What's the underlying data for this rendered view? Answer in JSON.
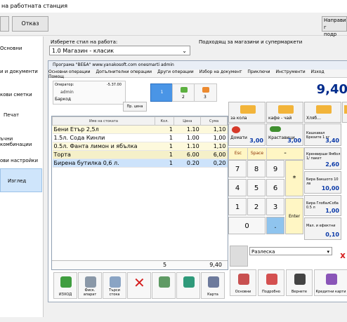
{
  "window": {
    "title": "на работната станция"
  },
  "toolbar": {
    "ok_label": "",
    "cancel_label": "Отказ",
    "right_label_1": "Направи г",
    "right_label_2": "подр"
  },
  "sidebar": {
    "items": [
      {
        "label": "Основни"
      },
      {
        "label": "и и документи"
      },
      {
        "label": "кови сметки"
      },
      {
        "label": "Печат"
      },
      {
        "label": "ъчни комбинации"
      },
      {
        "label": "ови настройки"
      },
      {
        "label": "Изглед"
      }
    ]
  },
  "main": {
    "style_label": "Изберете стил на работа:",
    "style_value": "1.0 Магазин - класик",
    "style_hint": "Подходящ за магазини и супермаркети"
  },
  "pos": {
    "title": "Програма \"ВЕБА\" www.yanakosoft.com   onesmarti admin",
    "menu": [
      "Основни операции",
      "Допълнителни операции",
      "Други операции",
      "Избор на документ",
      "Приключи",
      "Инструменти",
      "Изход",
      "Помощ"
    ],
    "operator": "Оператор:",
    "operator_value": "-5.37.00",
    "user": "admin",
    "barcode_label": "Баркод",
    "price_check_label": "Пр. цена",
    "tabs": [
      "1",
      "2",
      "3"
    ],
    "table": {
      "headers": [
        "Име на стоката",
        "Кол.",
        "Цена",
        "Сума"
      ],
      "rows": [
        {
          "name": "Бени Етър 2,5л",
          "qty": "1",
          "price": "1.10",
          "sum": "1,10"
        },
        {
          "name": "1.5л. Сода Кинли",
          "qty": "1",
          "price": "1.00",
          "sum": "1,00"
        },
        {
          "name": "0.5л. Фанта лимон и ябълка",
          "qty": "1",
          "price": "1.10",
          "sum": "1,10"
        },
        {
          "name": "Торта",
          "qty": "1",
          "price": "6.00",
          "sum": "6,00"
        },
        {
          "name": "Бирена бутилка 0,6 л.",
          "qty": "1",
          "price": "0.20",
          "sum": "0,20"
        }
      ],
      "total_qty": "5",
      "total_sum": "9,40"
    },
    "total": "9,40",
    "categories": [
      "за кола",
      "кафе - чай",
      "Хляб...",
      ""
    ],
    "products": [
      {
        "name": "Домати",
        "price": "3,00"
      },
      {
        "name": "Краставици",
        "price": "3,00"
      },
      {
        "name": "Кашкавал Брезите 1 кг",
        "price": "3,40"
      },
      {
        "name": "Кренвирши Ямбол 1/ пакет",
        "price": "2,60"
      },
      {
        "name": "Бира Бакшото 10 лв",
        "price": "10,00"
      },
      {
        "name": "Бира ГлобалСоба 0.5 л",
        "price": "1,00"
      },
      {
        "name": "Мал. и ефектни",
        "price": "0,10"
      }
    ],
    "keys": {
      "esc": "Esc",
      "space": "Space",
      "minus": "-",
      "star": "*",
      "enter": "Enter",
      "digits": [
        "7",
        "8",
        "9",
        "4",
        "5",
        "6",
        "1",
        "2",
        "3",
        "0",
        "."
      ]
    },
    "client": "Разлеска",
    "footer_tools": [
      "ИЗХОД",
      "Фиск. апарат",
      "Търси стока",
      "",
      "",
      "",
      "Карта"
    ],
    "bottom_tools": [
      "Основни",
      "Подробно",
      "Вернете",
      "Кредитни карти"
    ]
  }
}
